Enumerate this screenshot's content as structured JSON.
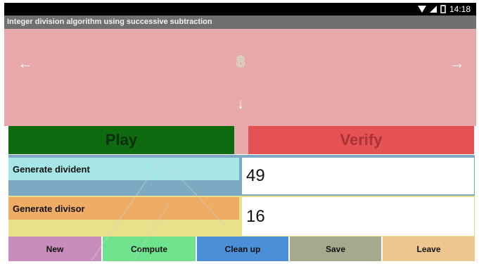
{
  "status": {
    "time": "14:18",
    "icons": [
      "wifi-icon",
      "signal-icon",
      "battery-icon"
    ]
  },
  "app": {
    "title": "Integer division algorithm using successive subtraction"
  },
  "canvas": {
    "left_arrow": "←",
    "right_arrow": "→",
    "down_arrow": "↓",
    "marker": "8"
  },
  "actions": {
    "play": "Play",
    "verify": "Verify"
  },
  "fields": {
    "dividend": {
      "label": "Generate divident",
      "value": "49"
    },
    "divisor": {
      "label": "Generate divisor",
      "value": "16"
    }
  },
  "bottom_buttons": [
    "New",
    "Compute",
    "Clean up",
    "Save",
    "Leave"
  ],
  "colors": {
    "status_bg": "#000000",
    "title_bg": "#6f6f6f",
    "canvas_bg": "#e8a9ab",
    "play_bg": "#0e6b10",
    "verify_bg": "#e55254",
    "dividend_label_bg": "#a6e6e6",
    "dividend_row_bg": "#7ea9c2",
    "divisor_label_bg": "#eeac64",
    "divisor_row_bg": "#e9e08b",
    "new_bg": "#c98dbd",
    "compute_bg": "#6ee28d",
    "cleanup_bg": "#4a8fd7",
    "save_bg": "#a6a98e",
    "leave_bg": "#ecc68d"
  }
}
